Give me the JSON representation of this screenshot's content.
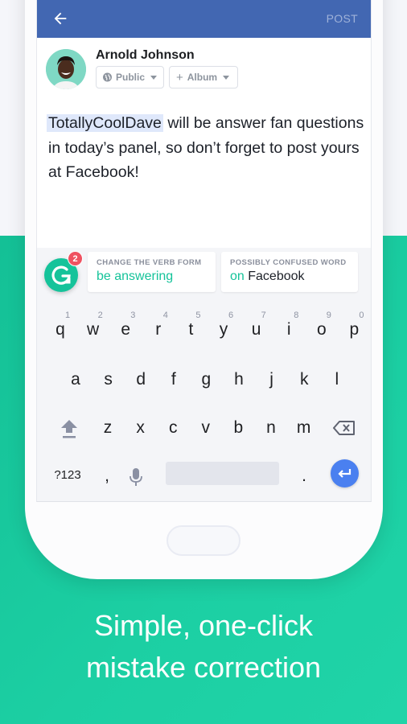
{
  "appbar": {
    "post_label": "POST",
    "back_icon": "arrow-left-icon",
    "color": "#4267b2"
  },
  "composer": {
    "user_name": "Arnold Johnson",
    "privacy_chip": {
      "label": "Public",
      "icon": "globe-icon"
    },
    "album_chip": {
      "label": "Album",
      "icon": "plus-icon"
    },
    "post": {
      "mention": "TotallyCoolDave",
      "text": " will be answer fan questions in today’s panel, so don’t forget to post yours at Facebook!"
    }
  },
  "grammarly": {
    "badge_count": "2",
    "brand_color": "#15c39a",
    "suggestions": [
      {
        "title": "CHANGE THE VERB FORM",
        "replacement": "be answering",
        "rest": ""
      },
      {
        "title": "POSSIBLY CONFUSED WORD",
        "replacement": "on",
        "rest": " Facebook"
      }
    ]
  },
  "keyboard": {
    "row1": [
      {
        "key": "q",
        "num": "1"
      },
      {
        "key": "w",
        "num": "2"
      },
      {
        "key": "e",
        "num": "3"
      },
      {
        "key": "r",
        "num": "4"
      },
      {
        "key": "t",
        "num": "5"
      },
      {
        "key": "y",
        "num": "6"
      },
      {
        "key": "u",
        "num": "7"
      },
      {
        "key": "i",
        "num": "8"
      },
      {
        "key": "o",
        "num": "9"
      },
      {
        "key": "p",
        "num": "0"
      }
    ],
    "row2": [
      "a",
      "s",
      "d",
      "f",
      "g",
      "h",
      "j",
      "k",
      "l"
    ],
    "row3": [
      "z",
      "x",
      "c",
      "v",
      "b",
      "n",
      "m"
    ],
    "symbols_label": "?123",
    "comma": ",",
    "period": ".",
    "enter_color": "#4a80f0"
  },
  "tagline": {
    "line1": "Simple, one-click",
    "line2": "mistake correction"
  }
}
